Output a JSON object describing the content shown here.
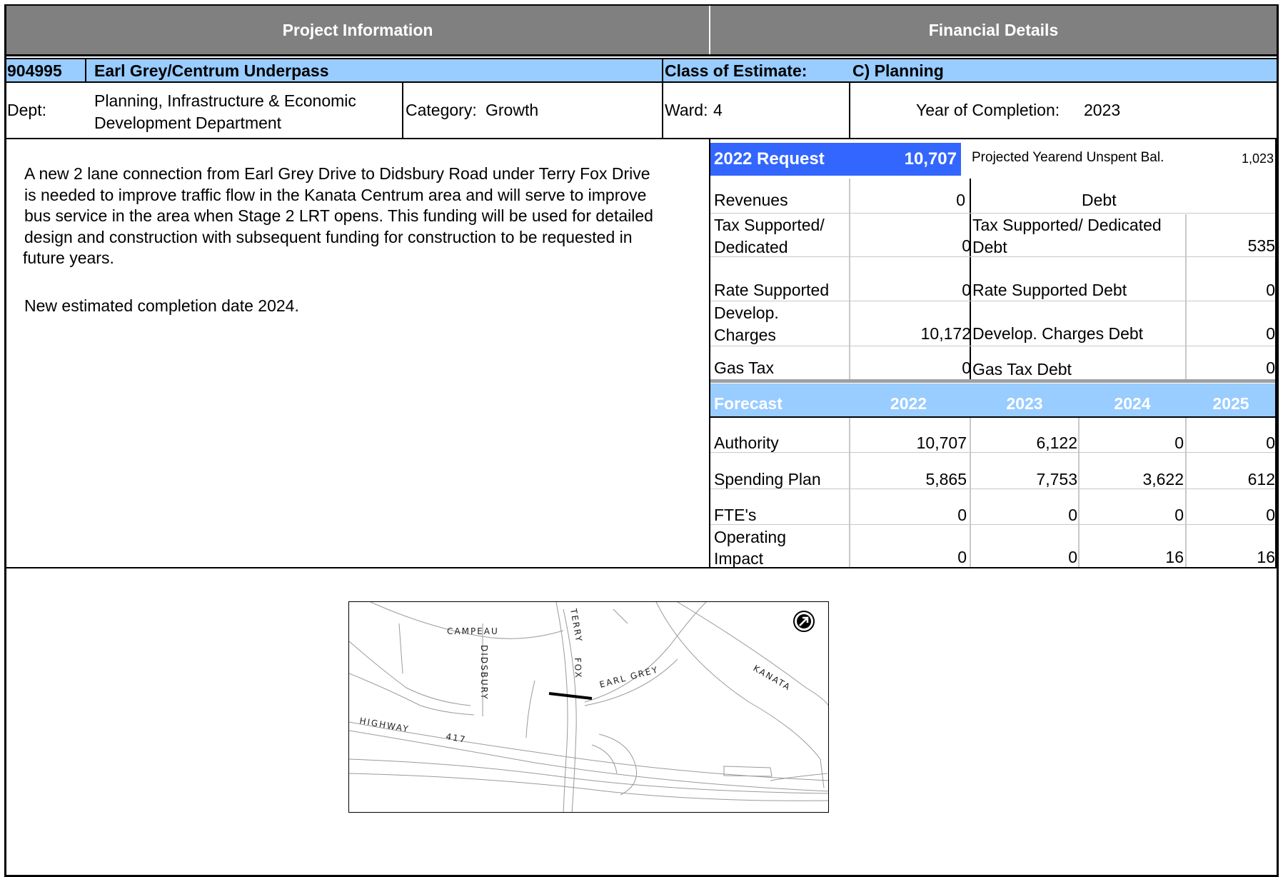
{
  "headers": {
    "project_info": "Project Information",
    "financial": "Financial Details"
  },
  "project": {
    "number": "904995",
    "name": "Earl Grey/Centrum Underpass",
    "class_label": "Class of Estimate:",
    "class_value": "C) Planning",
    "dept_label": "Dept:",
    "dept_line1": "Planning, Infrastructure & Economic",
    "dept_line2": "Development Department",
    "category_label": "Category:",
    "category_value": "Growth",
    "ward_label": "Ward:",
    "ward_value": "4",
    "completion_label": "Year of Completion:",
    "completion_value": "2023",
    "description": [
      "A new 2 lane connection from Earl Grey Drive to Didsbury Road under Terry Fox Drive",
      "is needed to improve traffic flow in the Kanata Centrum area and will serve to improve",
      "bus service in the area when Stage 2 LRT opens. This funding will be used for detailed",
      "design and construction with subsequent funding for construction to be requested in",
      "future years."
    ],
    "note": "New estimated completion date 2024."
  },
  "request": {
    "label": "2022 Request",
    "value": "10,707",
    "unspent_label": "Projected Yearend Unspent Bal.",
    "unspent_value": "1,023"
  },
  "funding": {
    "revenues_label": "Revenues",
    "revenues_value": "0",
    "debt_header": "Debt",
    "tax_label_1": "Tax Supported/",
    "tax_label_2": "Dedicated",
    "tax_value": "0",
    "tax_debt_label_1": "Tax Supported/ Dedicated",
    "tax_debt_label_2": "Debt",
    "tax_debt_value": "535",
    "rate_label": "Rate Supported",
    "rate_value": "0",
    "rate_debt_label": "Rate Supported Debt",
    "rate_debt_value": "0",
    "dev_label_1": "Develop.",
    "dev_label_2": "Charges",
    "dev_value": "10,172",
    "dev_debt_label": "Develop. Charges Debt",
    "dev_debt_value": "0",
    "gas_label": "Gas Tax",
    "gas_value": "0",
    "gas_debt_label": "Gas Tax Debt",
    "gas_debt_value": "0"
  },
  "forecast": {
    "header": "Forecast",
    "years": [
      "2022",
      "2023",
      "2024",
      "2025"
    ],
    "rows": [
      {
        "label": "Authority",
        "values": [
          "10,707",
          "6,122",
          "0",
          "0"
        ]
      },
      {
        "label": "Spending Plan",
        "values": [
          "5,865",
          "7,753",
          "3,622",
          "612"
        ]
      },
      {
        "label": "FTE's",
        "values": [
          "0",
          "0",
          "0",
          "0"
        ]
      },
      {
        "label_1": "Operating",
        "label_2": "Impact",
        "values": [
          "0",
          "0",
          "16",
          "16"
        ]
      }
    ]
  },
  "map": {
    "labels": {
      "campeau": "CAMPEAU",
      "didsbury": "DIDSBURY",
      "terry": "TERRY",
      "fox": "FOX",
      "earl_grey": "EARL GREY",
      "kanata": "KANATA",
      "highway": "HIGHWAY",
      "h417": "417"
    },
    "north_icon": "north-arrow-icon"
  },
  "colors": {
    "header_gray": "#808080",
    "light_blue": "#99ccff",
    "request_blue": "#3366ff"
  }
}
